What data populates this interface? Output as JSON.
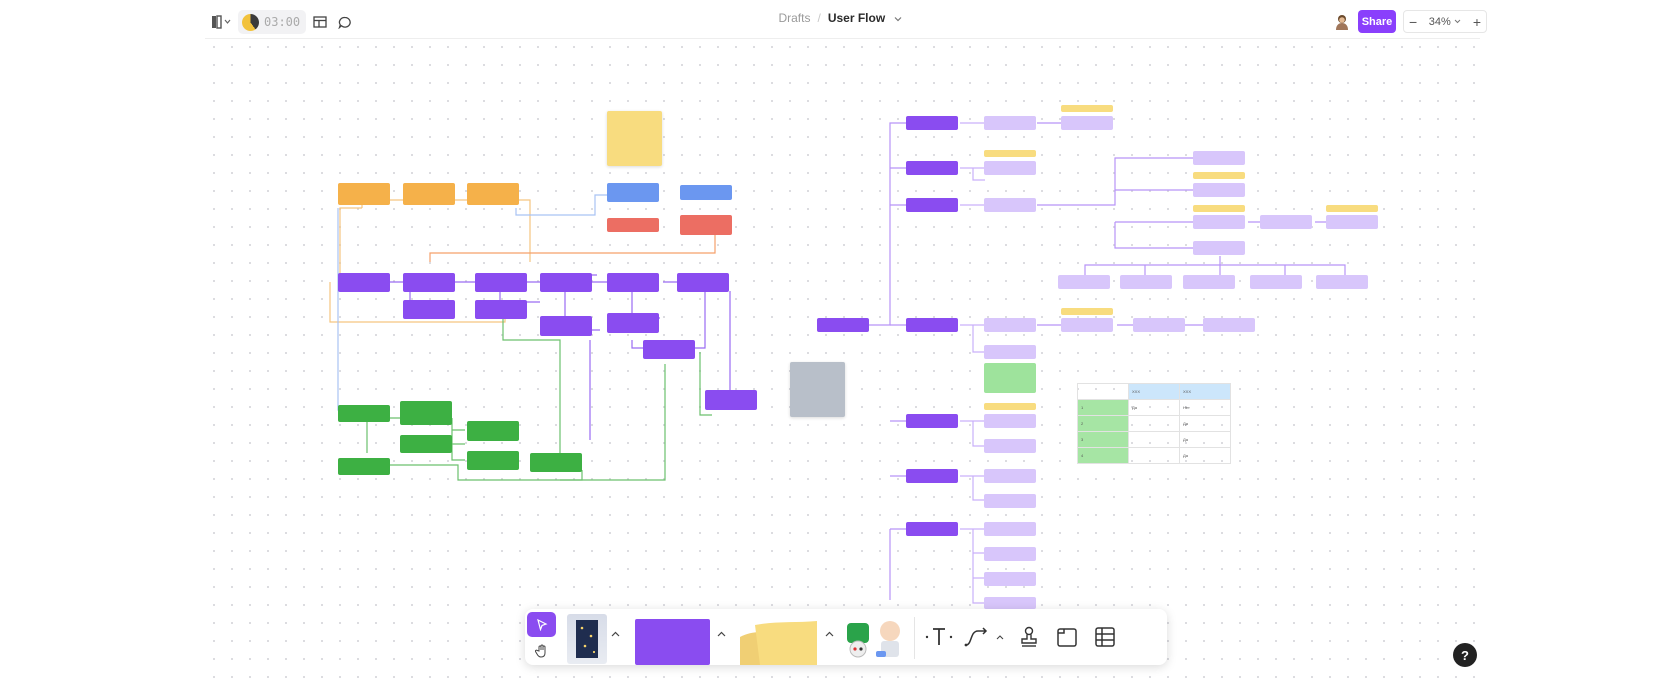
{
  "topbar": {
    "timer": "03:00",
    "breadcrumb_parent": "Drafts",
    "breadcrumb_separator": "/",
    "board_title": "User Flow",
    "share_label": "Share",
    "zoom_level": "34%",
    "zoom_minus": "−",
    "zoom_plus": "+"
  },
  "canvas": {
    "table": {
      "headers": [
        "",
        "ХХХ",
        "ХХХ"
      ],
      "rows": [
        [
          "1",
          "Да",
          "Нет"
        ],
        [
          "2",
          "",
          "Да"
        ],
        [
          "3",
          "",
          "Да"
        ],
        [
          "4",
          "",
          "Да"
        ]
      ]
    }
  },
  "help": "?",
  "colors": {
    "accent": "#8a3ffc",
    "orange": "#f5b14a",
    "purple": "#8a4cf0",
    "light_purple": "#d8c6fb",
    "green": "#3db043",
    "red": "#ec6e63",
    "blue": "#6b97f0",
    "yellow": "#f8dc7f"
  }
}
